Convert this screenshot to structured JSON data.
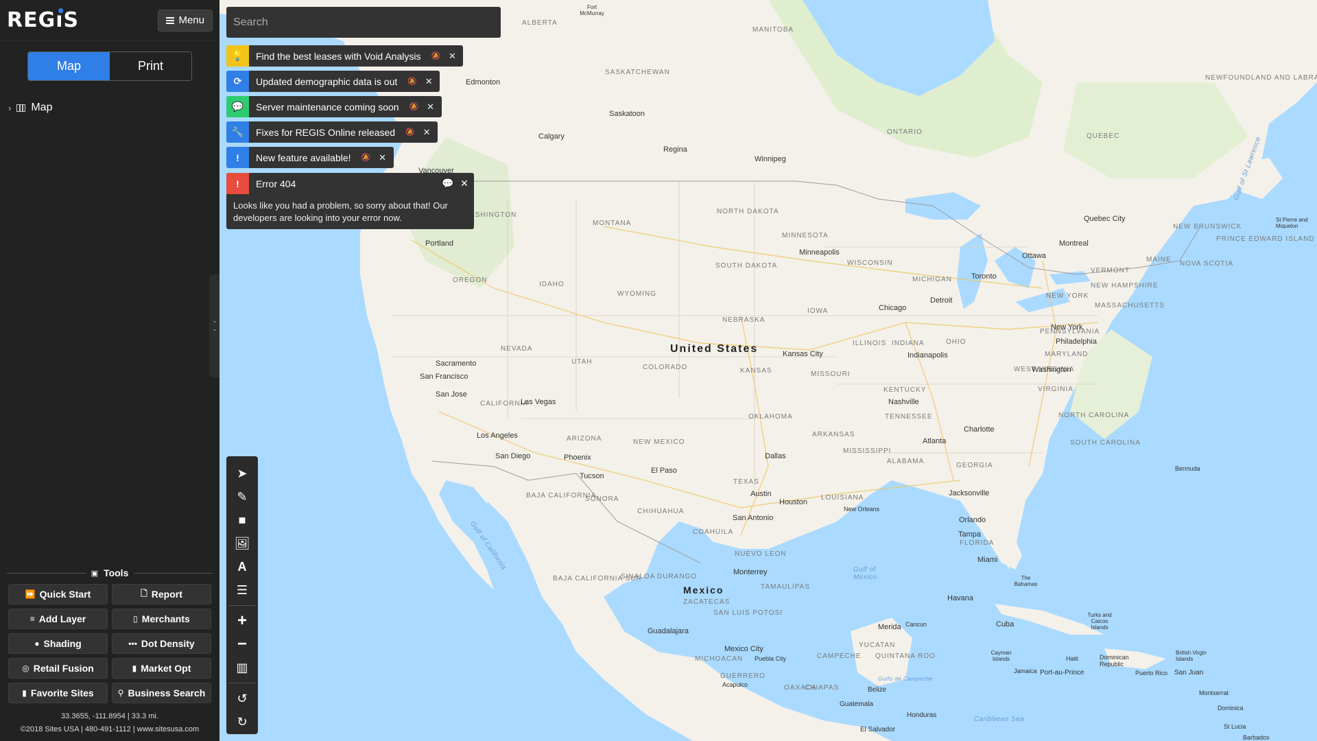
{
  "app": {
    "logo": "REGiS",
    "menu_label": "Menu"
  },
  "sidebar": {
    "tabs": [
      {
        "label": "Map"
      },
      {
        "label": "Print"
      }
    ],
    "tree_item": "Map",
    "tools_title": "Tools",
    "tools": [
      {
        "label": "Quick Start",
        "icon": "rocket-icon",
        "glyph": "⏩"
      },
      {
        "label": "Report",
        "icon": "file-icon",
        "glyph": "🗋"
      },
      {
        "label": "Add Layer",
        "icon": "layers-icon",
        "glyph": "≡"
      },
      {
        "label": "Merchants",
        "icon": "building-icon",
        "glyph": "▯"
      },
      {
        "label": "Shading",
        "icon": "palette-icon",
        "glyph": "●"
      },
      {
        "label": "Dot Density",
        "icon": "dots-icon",
        "glyph": "•••"
      },
      {
        "label": "Retail Fusion",
        "icon": "target-icon",
        "glyph": "◎"
      },
      {
        "label": "Market Opt",
        "icon": "thermometer-icon",
        "glyph": "▮"
      },
      {
        "label": "Favorite Sites",
        "icon": "bookmark-icon",
        "glyph": "▮"
      },
      {
        "label": "Business Search",
        "icon": "search-icon",
        "glyph": "⚲"
      }
    ],
    "coords": "33.3655, -111.8954 | 33.3 mi.",
    "copyright": "©2018 Sites USA | 480-491-1112 | www.sitesusa.com"
  },
  "search": {
    "placeholder": "Search"
  },
  "notifications": [
    {
      "text": "Find the best leases with Void Analysis",
      "color": "#f0c419",
      "glyph": "💡",
      "icon": "lightbulb-icon"
    },
    {
      "text": "Updated demographic data is out",
      "color": "#2f7fe6",
      "glyph": "⟳",
      "icon": "refresh-icon"
    },
    {
      "text": "Server maintenance coming soon",
      "color": "#2ecc71",
      "glyph": "💬",
      "icon": "chat-icon"
    },
    {
      "text": "Fixes for REGIS Online released",
      "color": "#2f7fe6",
      "glyph": "🔧",
      "icon": "wrench-icon"
    },
    {
      "text": "New feature available!",
      "color": "#2f7fe6",
      "glyph": "!",
      "icon": "exclamation-icon"
    }
  ],
  "error": {
    "title": "Error 404",
    "message": "Looks like you had a problem, so sorry about that! Our developers are looking into your error now."
  },
  "map_labels": {
    "countries": [
      "United States",
      "Mexico"
    ],
    "states": [
      "ALBERTA",
      "MANITOBA",
      "SASKATCHEWAN",
      "ONTARIO",
      "QUEBEC",
      "NEWFOUNDLAND AND LABRADOR",
      "NORTH DAKOTA",
      "MONTANA",
      "MINNESOTA",
      "SOUTH DAKOTA",
      "WISCONSIN",
      "MICHIGAN",
      "OREGON",
      "IDAHO",
      "WYOMING",
      "IOWA",
      "NEBRASKA",
      "NEVADA",
      "UTAH",
      "COLORADO",
      "KANSAS",
      "MISSOURI",
      "ILLINOIS",
      "INDIANA",
      "OHIO",
      "CALIFORNIA",
      "ARIZONA",
      "NEW MEXICO",
      "OKLAHOMA",
      "ARKANSAS",
      "TENNESSEE",
      "KENTUCKY",
      "WEST VIRGINIA",
      "VIRGINIA",
      "NORTH CAROLINA",
      "SOUTH CAROLINA",
      "GEORGIA",
      "ALABAMA",
      "MISSISSIPPI",
      "LOUISIANA",
      "TEXAS",
      "FLORIDA",
      "NEW YORK",
      "PENNSYLVANIA",
      "MAINE",
      "VERMONT",
      "NEW BRUNSWICK",
      "NOVA SCOTIA",
      "MASSACHUSETTS",
      "MARYLAND",
      "NEW HAMPSHIRE",
      "SONORA",
      "CHIHUAHUA",
      "COAHUILA",
      "NUEVO LEON",
      "DURANGO",
      "SINALOA",
      "TAMAULIPAS",
      "BAJA CALIFORNIA",
      "BAJA CALIFORNIA SUR",
      "SAN LUIS POTOSI",
      "ZACATECAS",
      "GUERRERO",
      "OAXACA",
      "CHIAPAS",
      "YUCATAN",
      "CAMPECHE",
      "QUINTANA ROO",
      "MICHOACAN",
      "PRINCE EDWARD ISLAND",
      "WASHINGTON"
    ],
    "cities": [
      "Edmonton",
      "Calgary",
      "Saskatoon",
      "Regina",
      "Winnipeg",
      "Vancouver",
      "Portland",
      "Sacramento",
      "San Francisco",
      "San Jose",
      "Los Angeles",
      "San Diego",
      "Las Vegas",
      "Phoenix",
      "Tucson",
      "El Paso",
      "Minneapolis",
      "Chicago",
      "Detroit",
      "Toronto",
      "Ottawa",
      "Montreal",
      "Quebec City",
      "New York",
      "Philadelphia",
      "Washington",
      "Indianapolis",
      "Kansas City",
      "Nashville",
      "Charlotte",
      "Atlanta",
      "Dallas",
      "Austin",
      "Houston",
      "San Antonio",
      "New Orleans",
      "Jacksonville",
      "Orlando",
      "Tampa",
      "Miami",
      "Monterrey",
      "Guadalajara",
      "Mexico City",
      "Puebla City",
      "Merida",
      "Cancun",
      "Havana",
      "Cuba",
      "Belize",
      "Guatemala",
      "Honduras",
      "El Salvador",
      "Jamaica",
      "Haiti",
      "Dominican Republic",
      "Port-au-Prince",
      "Puerto Rico",
      "San Juan",
      "Bermuda",
      "Fort McMurray",
      "St Pierre and Miquelon",
      "The Bahamas",
      "Turks and Caicos Islands",
      "Cayman Islands",
      "British Virgin Islands",
      "Montserrat",
      "Dominica",
      "St Lucia",
      "Barbados",
      "Acapulco"
    ],
    "seas": [
      "Gulf of Mexico",
      "Gulf of California",
      "Caribbean Sea",
      "Gulf of St Lawrence",
      "Golfo de Campeche"
    ]
  },
  "colors": {
    "sidebar_bg": "#222222",
    "accent": "#2f7fe6",
    "error": "#e74c3c",
    "ocean": "#aadaff",
    "land": "#f4f1ea"
  },
  "map_toolbar": [
    {
      "name": "select-tool-icon",
      "glyph": "➤"
    },
    {
      "name": "draw-tool-icon",
      "glyph": "✎"
    },
    {
      "name": "rectangle-tool-icon",
      "glyph": "■"
    },
    {
      "name": "image-tool-icon",
      "glyph": "🖼"
    },
    {
      "name": "text-tool-icon",
      "glyph": "A"
    },
    {
      "name": "settings-sliders-icon",
      "glyph": "☰"
    },
    {
      "name": "zoom-in-icon",
      "glyph": "+"
    },
    {
      "name": "zoom-out-icon",
      "glyph": "−"
    },
    {
      "name": "basemap-icon",
      "glyph": "▥"
    },
    {
      "name": "undo-icon",
      "glyph": "↺"
    },
    {
      "name": "redo-icon",
      "glyph": "↻"
    }
  ]
}
